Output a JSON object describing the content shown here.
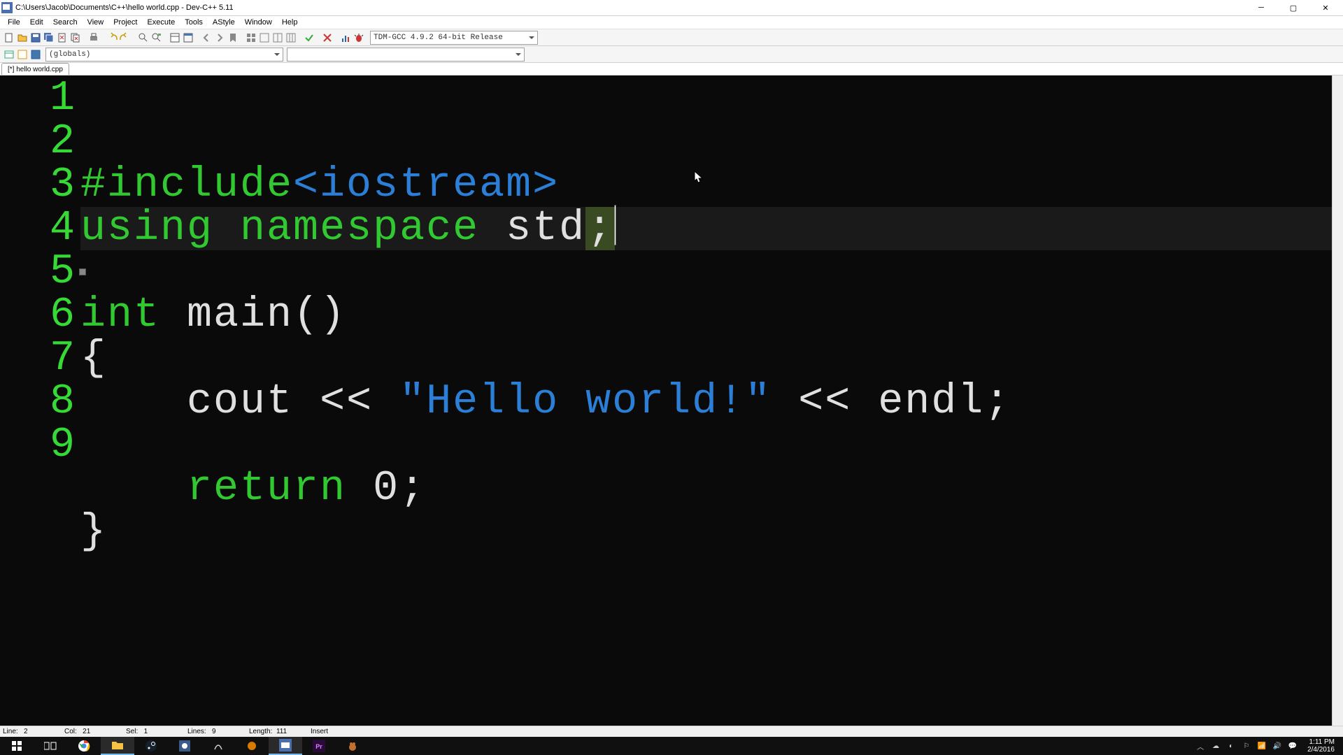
{
  "window": {
    "title": "C:\\Users\\Jacob\\Documents\\C++\\hello world.cpp - Dev-C++ 5.11"
  },
  "menu": {
    "items": [
      "File",
      "Edit",
      "Search",
      "View",
      "Project",
      "Execute",
      "Tools",
      "AStyle",
      "Window",
      "Help"
    ]
  },
  "toolbar": {
    "compiler": "TDM-GCC 4.9.2 64-bit Release"
  },
  "toolbar2": {
    "scope": "(globals)",
    "member": ""
  },
  "tabs": {
    "items": [
      "[*] hello world.cpp"
    ]
  },
  "code": {
    "lines": [
      {
        "n": "1",
        "segments": [
          {
            "cls": "tk-pre",
            "t": "#include"
          },
          {
            "cls": "tk-hdr",
            "t": "<iostream>"
          }
        ]
      },
      {
        "n": "2",
        "active": true,
        "segments": [
          {
            "cls": "tk-kw",
            "t": "using"
          },
          {
            "cls": "tk-id",
            "t": " "
          },
          {
            "cls": "tk-kw",
            "t": "namespace"
          },
          {
            "cls": "tk-id",
            "t": " std"
          },
          {
            "cls": "tk-op semicolon-box",
            "t": ";"
          }
        ],
        "caret": true
      },
      {
        "n": "3",
        "segments": []
      },
      {
        "n": "4",
        "segments": [
          {
            "cls": "tk-kw",
            "t": "int"
          },
          {
            "cls": "tk-id",
            "t": " main"
          },
          {
            "cls": "tk-op",
            "t": "()"
          }
        ]
      },
      {
        "n": "5",
        "fold": true,
        "segments": [
          {
            "cls": "tk-op",
            "t": "{"
          }
        ]
      },
      {
        "n": "6",
        "segments": [
          {
            "cls": "tk-id",
            "t": "    cout "
          },
          {
            "cls": "tk-op",
            "t": "<<"
          },
          {
            "cls": "tk-id",
            "t": " "
          },
          {
            "cls": "tk-str",
            "t": "\"Hello world!\""
          },
          {
            "cls": "tk-id",
            "t": " "
          },
          {
            "cls": "tk-op",
            "t": "<<"
          },
          {
            "cls": "tk-id",
            "t": " endl"
          },
          {
            "cls": "tk-op",
            "t": ";"
          }
        ]
      },
      {
        "n": "7",
        "segments": []
      },
      {
        "n": "8",
        "segments": [
          {
            "cls": "tk-id",
            "t": "    "
          },
          {
            "cls": "tk-kw",
            "t": "return"
          },
          {
            "cls": "tk-id",
            "t": " "
          },
          {
            "cls": "tk-num",
            "t": "0"
          },
          {
            "cls": "tk-op",
            "t": ";"
          }
        ]
      },
      {
        "n": "9",
        "segments": [
          {
            "cls": "tk-op",
            "t": "}"
          }
        ]
      }
    ]
  },
  "status": {
    "line_label": "Line:",
    "line": "2",
    "col_label": "Col:",
    "col": "21",
    "sel_label": "Sel:",
    "sel": "1",
    "lines_label": "Lines:",
    "lines": "9",
    "length_label": "Length:",
    "length": "111",
    "mode": "Insert"
  },
  "taskbar": {
    "time": "1:11 PM",
    "date": "2/4/2016"
  },
  "icons": {
    "new": "new-file-icon",
    "open": "open-icon",
    "save": "save-icon",
    "saveall": "save-all-icon",
    "close": "close-file-icon",
    "closeall": "close-all-icon",
    "print": "print-icon",
    "undo": "undo-icon",
    "redo": "redo-icon",
    "find": "find-icon",
    "replace": "replace-icon",
    "findfiles": "find-in-files-icon",
    "fullscreen": "fullscreen-icon",
    "next": "next-icon",
    "back": "nav-back-icon",
    "fwd": "nav-fwd-icon",
    "bookmark": "bookmark-icon",
    "gotobm": "goto-bm-icon",
    "dbg1": "debug-step-icon",
    "dbg2": "debug-over-icon",
    "dbg3": "debug-out-icon",
    "dbg4": "debug-stop-icon",
    "compile": "compile-icon",
    "run": "run-icon",
    "compilerun": "compile-run-icon",
    "rebuild": "rebuild-icon",
    "profiling": "profiling-icon",
    "debug": "debug-icon",
    "projpanel": "project-panel-icon",
    "classpanel": "class-panel-icon",
    "debugpanel": "debug-panel-icon"
  }
}
